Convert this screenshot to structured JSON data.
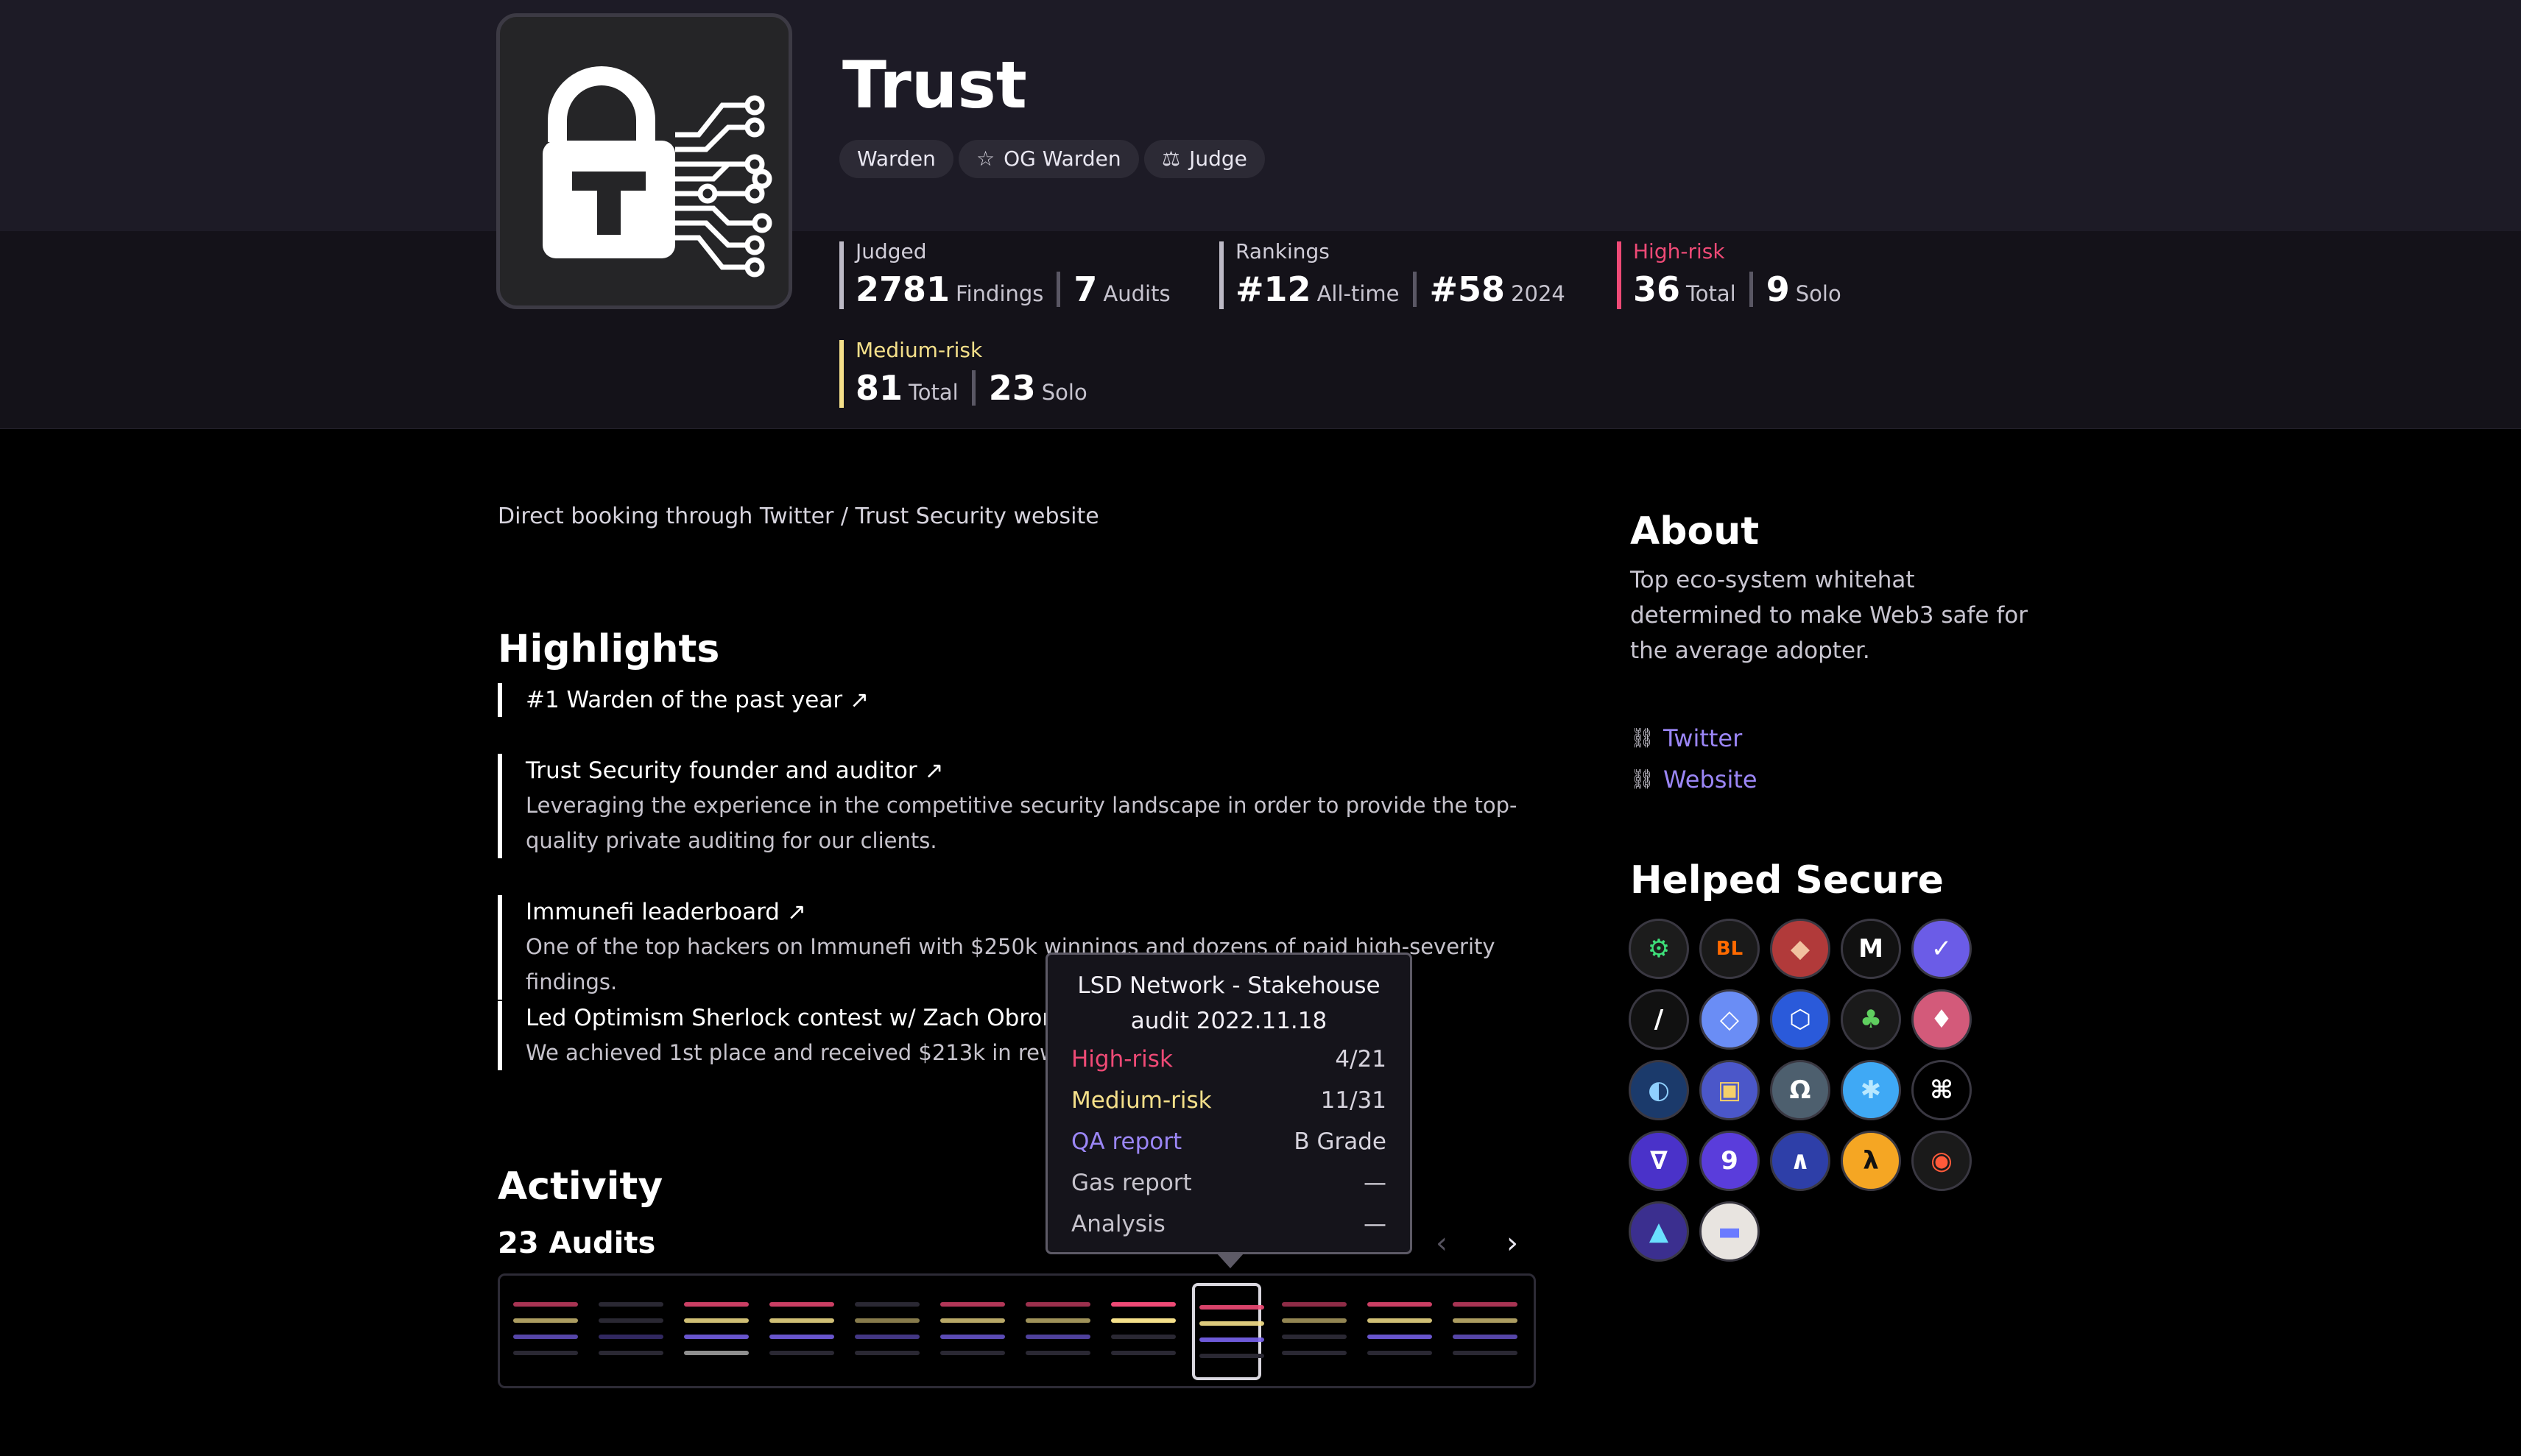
{
  "profile": {
    "name": "Trust",
    "badges": [
      "Warden",
      "OG Warden",
      "Judge"
    ]
  },
  "stats": {
    "judged": {
      "label": "Judged",
      "findings": "2781",
      "findings_unit": "Findings",
      "audits": "7",
      "audits_unit": "Audits"
    },
    "rankings": {
      "label": "Rankings",
      "alltime": "#12",
      "alltime_unit": "All-time",
      "year": "#58",
      "year_unit": "2024"
    },
    "high": {
      "label": "High-risk",
      "total": "36",
      "total_unit": "Total",
      "solo": "9",
      "solo_unit": "Solo"
    },
    "medium": {
      "label": "Medium-risk",
      "total": "81",
      "total_unit": "Total",
      "solo": "23",
      "solo_unit": "Solo"
    }
  },
  "booking": "Direct booking through Twitter / Trust Security website",
  "highlights": {
    "title": "Highlights",
    "items": [
      {
        "title": "#1 Warden of the past year ↗",
        "desc": ""
      },
      {
        "title": "Trust Security founder and auditor ↗",
        "desc": "Leveraging the experience in the competitive security landscape in order to provide the top-quality private auditing for our clients."
      },
      {
        "title": "Immunefi leaderboard ↗",
        "desc": "One of the top hackers on Immunefi with $250k winnings and dozens of paid high-severity findings."
      },
      {
        "title": "Led Optimism Sherlock contest w/ Zach Obront ↗",
        "desc": "We achieved 1st place and received $213k in rewards."
      }
    ]
  },
  "activity": {
    "title": "Activity",
    "subtitle": "23 Audits",
    "prev_icon": "‹",
    "next_icon": "›",
    "selected_index": 8
  },
  "tooltip": {
    "title": "LSD Network - Stakehouse audit 2022.11.18",
    "rows": [
      {
        "label": "High-risk",
        "value": "4/21",
        "color": "#ef4a76"
      },
      {
        "label": "Medium-risk",
        "value": "11/31",
        "color": "#f5e08a"
      },
      {
        "label": "QA report",
        "value": "B Grade",
        "color": "#9b86f6"
      },
      {
        "label": "Gas report",
        "value": "—",
        "color": "#c6c3cc"
      },
      {
        "label": "Analysis",
        "value": "—",
        "color": "#c6c3cc"
      }
    ]
  },
  "about": {
    "title": "About",
    "text": "Top eco-system whitehat determined to make Web3 safe for the average adopter.",
    "links": [
      "Twitter",
      "Website"
    ]
  },
  "helped_secure": {
    "title": "Helped Secure",
    "logos": [
      {
        "name": "logo-1",
        "icon": "⚙",
        "bg": "#1c1c1c",
        "fg": "#3ee07a"
      },
      {
        "name": "logo-blur",
        "icon": "BL",
        "bg": "#1a1a1a",
        "fg": "#ff6a00"
      },
      {
        "name": "logo-3",
        "icon": "◆",
        "bg": "#b13a3a",
        "fg": "#f1c2a0"
      },
      {
        "name": "logo-4",
        "icon": "M",
        "bg": "#111",
        "fg": "#fff"
      },
      {
        "name": "logo-5",
        "icon": "✓",
        "bg": "#6b5ce7",
        "fg": "#fff"
      },
      {
        "name": "logo-6",
        "icon": "/",
        "bg": "#111",
        "fg": "#fff"
      },
      {
        "name": "logo-7",
        "icon": "◇",
        "bg": "#6a8df5",
        "fg": "#fff"
      },
      {
        "name": "logo-8",
        "icon": "⬡",
        "bg": "#2a5ada",
        "fg": "#fff"
      },
      {
        "name": "logo-9",
        "icon": "♣",
        "bg": "#1a1a1a",
        "fg": "#5fcf5f"
      },
      {
        "name": "logo-10",
        "icon": "♦",
        "bg": "#d35a7a",
        "fg": "#fff"
      },
      {
        "name": "logo-11",
        "icon": "◐",
        "bg": "#1b3a6b",
        "fg": "#8fd0ff"
      },
      {
        "name": "logo-12",
        "icon": "▣",
        "bg": "#4b57c9",
        "fg": "#f5d06a"
      },
      {
        "name": "logo-13",
        "icon": "Ω",
        "bg": "#4d5f6e",
        "fg": "#fff"
      },
      {
        "name": "logo-14",
        "icon": "✱",
        "bg": "#3fa9f5",
        "fg": "#b8e8ff"
      },
      {
        "name": "logo-15",
        "icon": "⌘",
        "bg": "#000",
        "fg": "#fff"
      },
      {
        "name": "logo-16",
        "icon": "∇",
        "bg": "#4a32c9",
        "fg": "#fff"
      },
      {
        "name": "logo-17",
        "icon": "9",
        "bg": "#5a3ddb",
        "fg": "#fff"
      },
      {
        "name": "logo-18",
        "icon": "∧",
        "bg": "#2e3fa8",
        "fg": "#fff"
      },
      {
        "name": "logo-19",
        "icon": "λ",
        "bg": "#f5a623",
        "fg": "#111"
      },
      {
        "name": "logo-20",
        "icon": "◉",
        "bg": "#1a1a1a",
        "fg": "#ff5a3a"
      },
      {
        "name": "logo-21",
        "icon": "▲",
        "bg": "#3b2f8f",
        "fg": "#6ae0ff"
      },
      {
        "name": "logo-22",
        "icon": "▬",
        "bg": "#e8e4e0",
        "fg": "#6a7bff"
      }
    ]
  },
  "colors": {
    "high": "#ef4a76",
    "medium": "#f5e08a",
    "qa": "#7a64f0",
    "gas": "#a8a8a8"
  }
}
